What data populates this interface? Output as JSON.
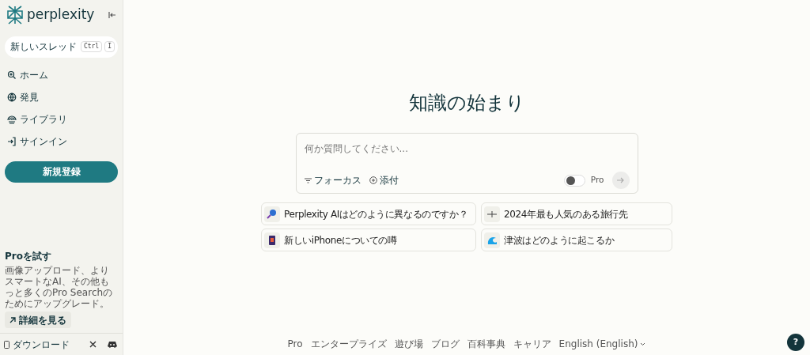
{
  "sidebar": {
    "logo": "perplexity",
    "new_thread": {
      "label": "新しいスレッド",
      "keys": [
        "Ctrl",
        "I"
      ]
    },
    "nav": [
      {
        "label": "ホーム"
      },
      {
        "label": "発見"
      },
      {
        "label": "ライブラリ"
      },
      {
        "label": "サインイン"
      }
    ],
    "signup": "新規登録",
    "promo": {
      "title": "Proを試す",
      "text": "画像アップロード、よりスマートなAI、その他もっと多くのPro Searchのためにアップグレード。",
      "button": "詳細を見る"
    },
    "footer": {
      "download": "ダウンロード"
    }
  },
  "main": {
    "heading": "知識の始まり",
    "search": {
      "placeholder": "何か質問してください...",
      "focus": "フォーカス",
      "attach": "添付",
      "pro_label": "Pro",
      "pro_on": false
    },
    "suggestions": [
      {
        "text": "Perplexity AIはどのように異なるのですか？",
        "kind": "search"
      },
      {
        "text": "2024年最も人気のある旅行先",
        "kind": "plane"
      },
      {
        "text": "新しいiPhoneについての噂",
        "kind": "phone"
      },
      {
        "text": "津波はどのように起こるか",
        "kind": "wave"
      }
    ],
    "footer_links": [
      "Pro",
      "エンタープライズ",
      "遊び場",
      "ブログ",
      "百科事典",
      "キャリア",
      "English (English)"
    ],
    "help": "?"
  }
}
